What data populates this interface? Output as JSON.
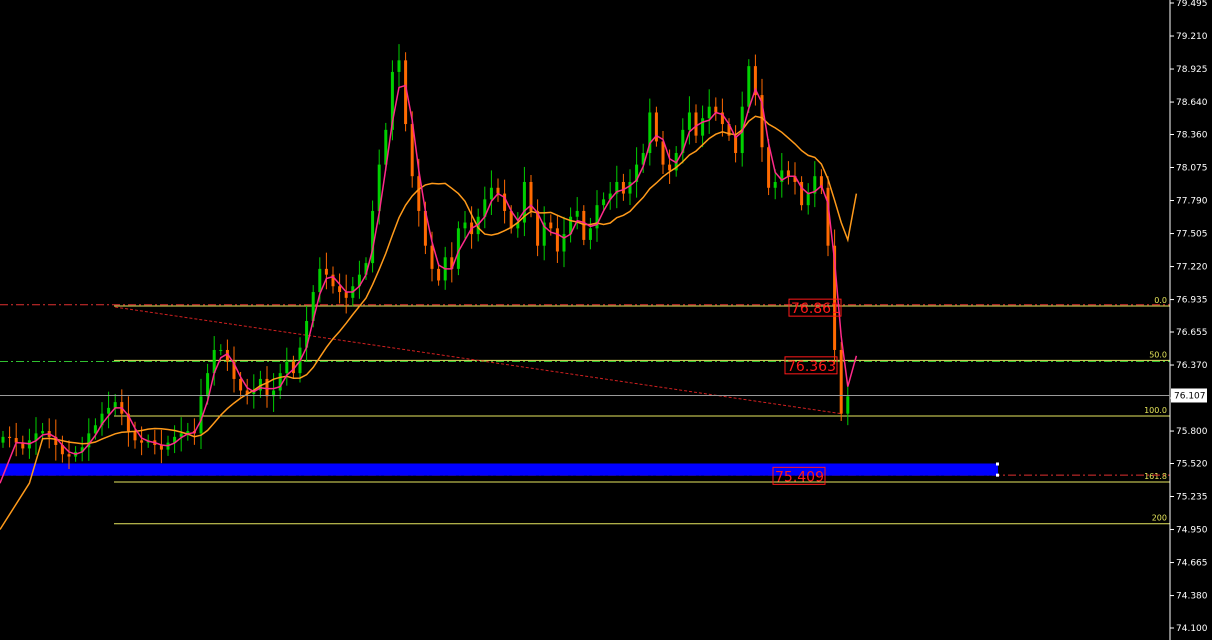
{
  "chart_data": {
    "type": "candlestick",
    "y_axis": {
      "min": 74.1,
      "max": 79.495,
      "ticks": [
        "79.495",
        "79.210",
        "78.925",
        "78.640",
        "78.360",
        "78.075",
        "77.790",
        "77.505",
        "77.220",
        "76.935",
        "76.655",
        "76.370",
        "76.085",
        "75.800",
        "75.520",
        "75.235",
        "74.950",
        "74.665",
        "74.380",
        "74.100"
      ]
    },
    "current_price": {
      "label": "76.107",
      "value": 76.107
    },
    "fibonacci": {
      "levels": [
        {
          "label": "0.0",
          "value": 76.88
        },
        {
          "label": "50.0",
          "value": 76.41
        },
        {
          "label": "100.0",
          "value": 75.93
        },
        {
          "label": "161.8",
          "value": 75.36
        },
        {
          "label": "200",
          "value": 75.0
        }
      ]
    },
    "horizontal_lines": [
      {
        "value": 76.89,
        "style": "dash-dot",
        "color": "#e03030"
      },
      {
        "value": 76.4,
        "style": "dash-dot",
        "color": "#30c030"
      },
      {
        "value": 75.42,
        "style": "dash-dot",
        "color": "#e03030"
      }
    ],
    "price_labels": [
      {
        "label": "76.861",
        "value": 76.861
      },
      {
        "label": "76.363",
        "value": 76.363
      },
      {
        "label": "75.409",
        "value": 75.409
      }
    ],
    "zone": {
      "from": 75.415,
      "to": 75.52,
      "color": "#0000ff"
    },
    "trendline": {
      "from_bar": 17,
      "from_value": 76.87,
      "to_bar": 127,
      "to_value": 75.95,
      "color": "#d02020"
    },
    "candles_close": [
      75.75,
      75.74,
      75.7,
      75.65,
      75.72,
      75.78,
      75.8,
      75.75,
      75.68,
      75.6,
      75.58,
      75.62,
      75.66,
      75.78,
      75.85,
      75.95,
      76.0,
      76.05,
      75.95,
      75.8,
      75.72,
      75.7,
      75.72,
      75.68,
      75.64,
      75.7,
      75.75,
      75.78,
      75.8,
      75.78,
      76.1,
      76.3,
      76.5,
      76.5,
      76.4,
      76.25,
      76.15,
      76.12,
      76.15,
      76.25,
      76.1,
      76.15,
      76.3,
      76.4,
      76.3,
      76.52,
      76.75,
      77.0,
      77.2,
      77.15,
      77.05,
      77.0,
      76.95,
      77.05,
      77.15,
      77.25,
      77.7,
      78.1,
      78.4,
      78.9,
      79.0,
      78.45,
      78.0,
      77.7,
      77.4,
      77.2,
      77.1,
      77.3,
      77.2,
      77.55,
      77.6,
      77.5,
      77.65,
      77.8,
      77.9,
      77.85,
      77.7,
      77.55,
      77.6,
      77.95,
      77.7,
      77.4,
      77.6,
      77.55,
      77.35,
      77.5,
      77.65,
      77.7,
      77.45,
      77.55,
      77.75,
      77.8,
      77.85,
      77.95,
      77.85,
      77.95,
      78.1,
      78.2,
      78.55,
      78.3,
      78.1,
      78.05,
      78.2,
      78.4,
      78.55,
      78.35,
      78.5,
      78.6,
      78.55,
      78.45,
      78.35,
      78.2,
      78.6,
      78.95,
      78.7,
      78.25,
      77.9,
      77.95,
      78.05,
      78.0,
      77.95,
      77.75,
      77.85,
      78.0,
      77.9,
      77.4,
      76.5,
      75.95,
      76.1
    ],
    "ma_fast_color": "#ff2a8a",
    "ma_slow_color": "#ff9a1a",
    "bull_color": "#00d000",
    "bear_color": "#ff6a00"
  }
}
